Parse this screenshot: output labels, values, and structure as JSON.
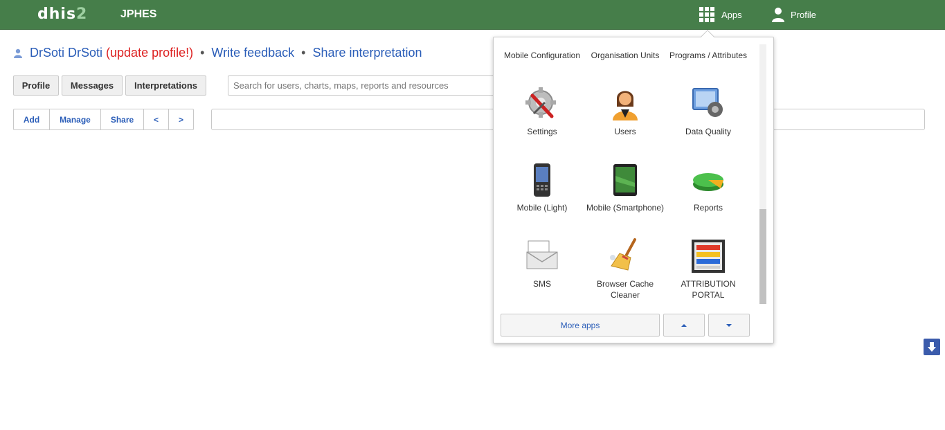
{
  "header": {
    "logo_text": "dhis",
    "logo_suffix": "2",
    "app_title": "JPHES",
    "apps_label": "Apps",
    "profile_label": "Profile",
    "background_color": "#467e4a"
  },
  "topline": {
    "user_name": "DrSoti DrSoti",
    "update_profile": "(update profile!)",
    "separator": "•",
    "write_feedback": "Write feedback",
    "share_interpretation": "Share interpretation"
  },
  "tabs": [
    {
      "label": "Profile"
    },
    {
      "label": "Messages"
    },
    {
      "label": "Interpretations"
    }
  ],
  "search": {
    "placeholder": "Search for users, charts, maps, reports and resources"
  },
  "toolbar": {
    "add": "Add",
    "manage": "Manage",
    "share": "Share",
    "prev": "<",
    "next": ">"
  },
  "apps_menu": {
    "items": [
      {
        "label": "Mobile Configuration",
        "icon": "mobile-config-icon"
      },
      {
        "label": "Organisation Units",
        "icon": "org-units-icon"
      },
      {
        "label": "Programs / Attributes",
        "icon": "programs-icon"
      },
      {
        "label": "Settings",
        "icon": "settings-icon"
      },
      {
        "label": "Users",
        "icon": "users-icon"
      },
      {
        "label": "Data Quality",
        "icon": "data-quality-icon"
      },
      {
        "label": "Mobile (Light)",
        "icon": "mobile-light-icon"
      },
      {
        "label": "Mobile (Smartphone)",
        "icon": "smartphone-icon"
      },
      {
        "label": "Reports",
        "icon": "reports-icon"
      },
      {
        "label": "SMS",
        "icon": "sms-icon"
      },
      {
        "label": "Browser Cache Cleaner",
        "icon": "broom-icon"
      },
      {
        "label": "ATTRIBUTION PORTAL",
        "icon": "attribution-portal-icon"
      }
    ],
    "more_apps": "More apps"
  }
}
